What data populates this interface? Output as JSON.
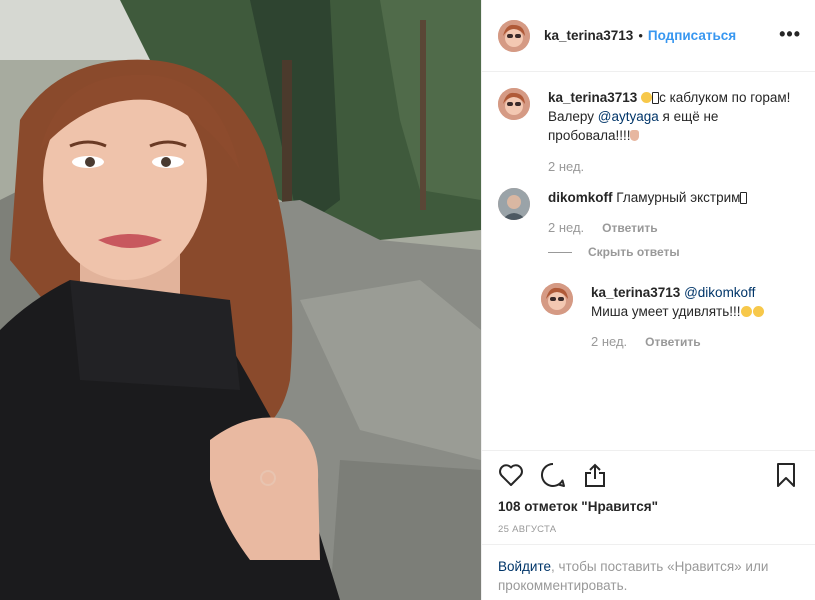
{
  "post": {
    "author": "ka_terina3713",
    "dot": "•",
    "follow_label": "Подписаться",
    "more_label": "•••",
    "photo_icon": "selfie-photo"
  },
  "comments": [
    {
      "user": "ka_terina3713",
      "text_before": "с каблуком по горам! Валеру",
      "mention": "@aytyaga",
      "text_after": "я ещё не пробовала!!!!",
      "time": "2 нед."
    },
    {
      "user": "dikomkoff",
      "text": "Гламурный экстрим",
      "time": "2 нед.",
      "reply_label": "Ответить",
      "hide_replies_label": "Скрыть ответы",
      "reply": {
        "user": "ka_terina3713",
        "mention": "@dikomkoff",
        "text": "Миша умеет удивлять!!!",
        "time": "2 нед.",
        "reply_label": "Ответить"
      }
    }
  ],
  "actions": {
    "like_icon": "heart-icon",
    "comment_icon": "comment-icon",
    "share_icon": "share-icon",
    "save_icon": "bookmark-icon",
    "likes_text": "108 отметок \"Нравится\"",
    "date_text": "25 АВГУСТА"
  },
  "login": {
    "link": "Войдите",
    "text": ", чтобы поставить «Нравится» или прокомментировать."
  },
  "colors": {
    "link_blue": "#3897f0",
    "mention_blue": "#003569",
    "muted": "#999999",
    "border": "#efefef"
  }
}
